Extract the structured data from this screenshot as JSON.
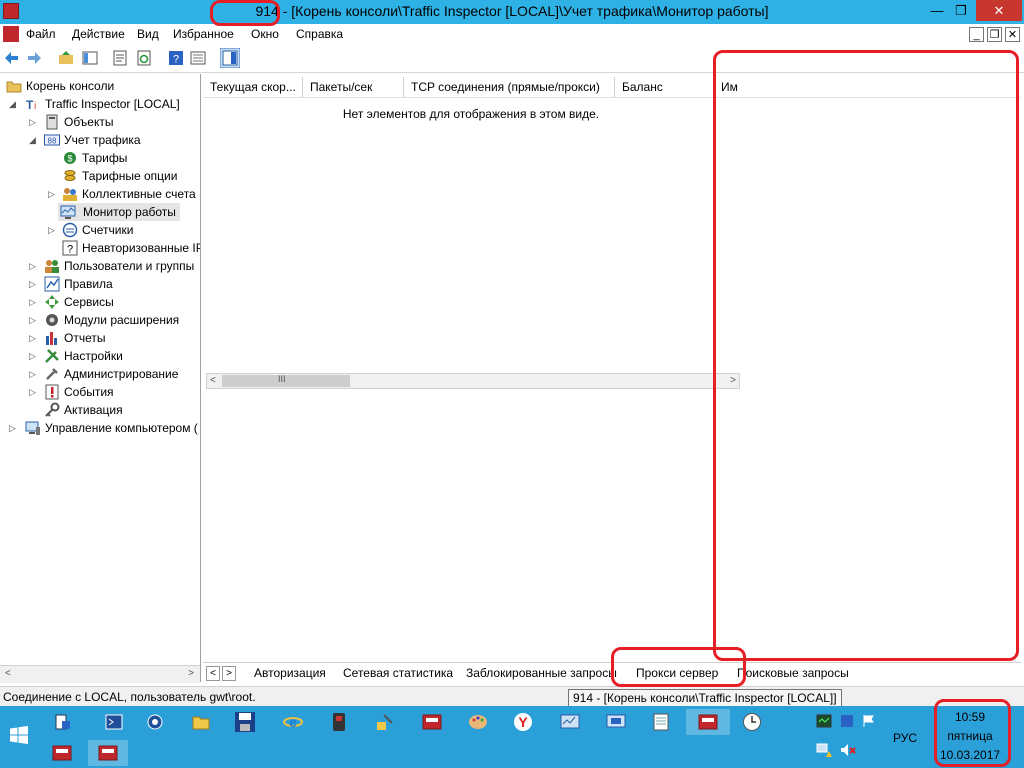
{
  "window": {
    "title": "914 - [Корень консоли\\Traffic Inspector [LOCAL]\\Учет трафика\\Монитор работы]",
    "minimize_glyph": "—",
    "maximize_glyph": "❐",
    "close_glyph": "✕"
  },
  "menu": {
    "items": [
      "Файл",
      "Действие",
      "Вид",
      "Избранное",
      "Окно",
      "Справка"
    ],
    "mdi_minimize": "_",
    "mdi_restore": "❐",
    "mdi_close": "✕"
  },
  "toolbar": {
    "icons": [
      "back-arrow-icon",
      "forward-arrow-icon",
      "up-folder-icon",
      "show-hide-tree-icon",
      "properties-icon",
      "refresh-icon",
      "help-icon",
      "export-list-icon",
      "show-action-pane-icon"
    ]
  },
  "tree": {
    "items": [
      {
        "label": "Корень консоли",
        "icon": "folder-icon"
      },
      {
        "label": "Traffic Inspector [LOCAL]",
        "icon": "ti-logo-icon"
      },
      {
        "label": "Объекты",
        "icon": "objects-icon"
      },
      {
        "label": "Учет трафика",
        "icon": "counter-88-icon"
      },
      {
        "label": "Тарифы",
        "icon": "tariff-icon"
      },
      {
        "label": "Тарифные опции",
        "icon": "coins-icon"
      },
      {
        "label": "Коллективные счета",
        "icon": "group-account-icon"
      },
      {
        "label": "Монитор работы",
        "icon": "monitor-icon"
      },
      {
        "label": "Счетчики",
        "icon": "counter-icon"
      },
      {
        "label": "Неавторизованные IP",
        "icon": "question-icon"
      },
      {
        "label": "Пользователи и группы",
        "icon": "users-icon"
      },
      {
        "label": "Правила",
        "icon": "rules-icon"
      },
      {
        "label": "Сервисы",
        "icon": "services-icon"
      },
      {
        "label": "Модули расширения",
        "icon": "modules-icon"
      },
      {
        "label": "Отчеты",
        "icon": "reports-icon"
      },
      {
        "label": "Настройки",
        "icon": "settings-icon"
      },
      {
        "label": "Администрирование",
        "icon": "admin-icon"
      },
      {
        "label": "События",
        "icon": "events-icon"
      },
      {
        "label": "Активация",
        "icon": "key-icon"
      },
      {
        "label": "Управление компьютером (",
        "icon": "computer-management-icon"
      }
    ]
  },
  "result": {
    "columns": [
      "Текущая скор...",
      "Пакеты/сек",
      "TCP соединения (прямые/прокси)",
      "Баланс",
      "Им"
    ],
    "empty_message": "Нет элементов для отображения в этом виде.",
    "scroll_grip": "III"
  },
  "tabs": {
    "items": [
      "Авторизация",
      "Сетевая статистика",
      "Заблокированные запросы",
      "Прокси сервер",
      "Поисковые запросы"
    ]
  },
  "status": {
    "text": "Соединение с LOCAL, пользователь gwt\\root.",
    "tooltip": "914 - [Корень консоли\\Traffic Inspector [LOCAL]]"
  },
  "taskbar": {
    "language": "РУС",
    "time": "10:59",
    "day": "пятница",
    "date": "10.03.2017"
  },
  "colors": {
    "titlebar": "#2eb2e6",
    "taskbar": "#2a9fd8",
    "highlight": "#e61e25",
    "close_button": "#c7372f"
  }
}
